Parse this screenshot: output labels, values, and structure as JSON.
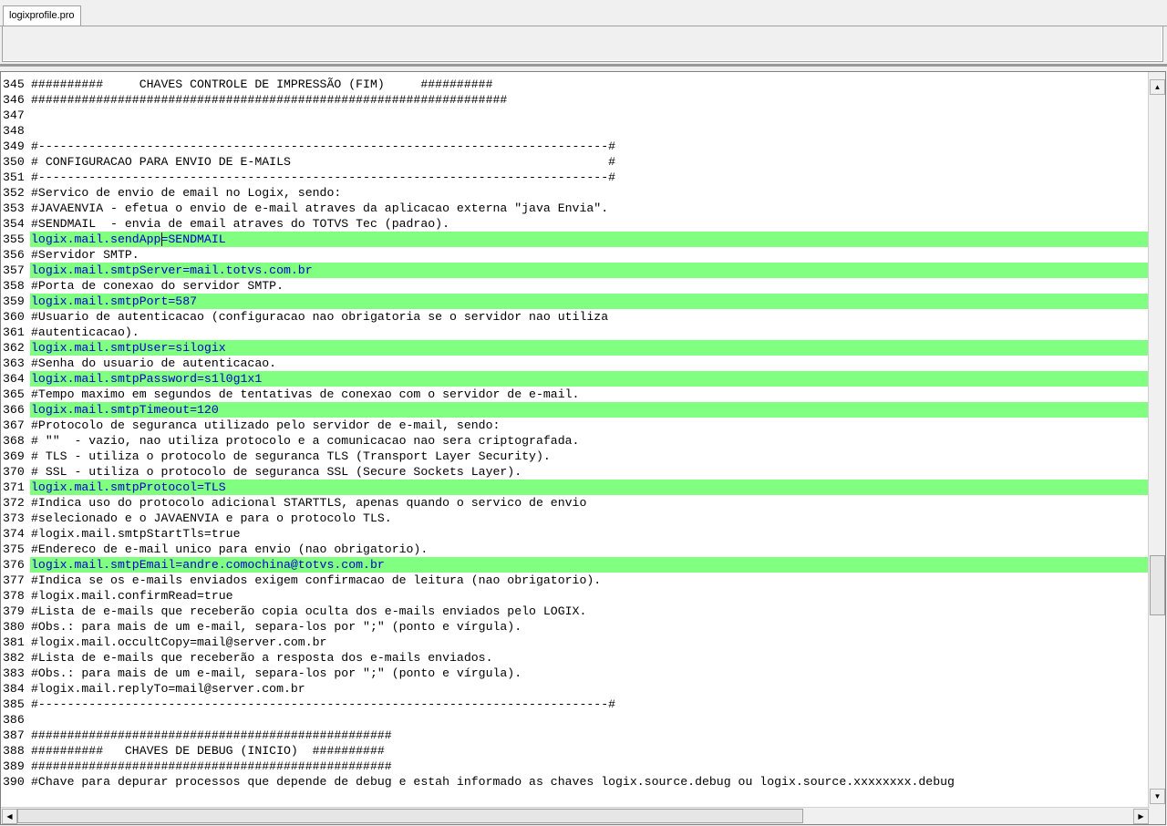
{
  "tab": {
    "label": "logixprofile.pro"
  },
  "editor": {
    "lines": [
      {
        "n": "345",
        "t": "##########     CHAVES CONTROLE DE IMPRESSÃO (FIM)     ##########",
        "hl": false
      },
      {
        "n": "346",
        "t": "##################################################################",
        "hl": false
      },
      {
        "n": "347",
        "t": "",
        "hl": false
      },
      {
        "n": "348",
        "t": "",
        "hl": false
      },
      {
        "n": "349",
        "t": "#-------------------------------------------------------------------------------#",
        "hl": false
      },
      {
        "n": "350",
        "t": "# CONFIGURACAO PARA ENVIO DE E-MAILS                                            #",
        "hl": false
      },
      {
        "n": "351",
        "t": "#-------------------------------------------------------------------------------#",
        "hl": false
      },
      {
        "n": "352",
        "t": "#Servico de envio de email no Logix, sendo:",
        "hl": false
      },
      {
        "n": "353",
        "t": "#JAVAENVIA - efetua o envio de e-mail atraves da aplicacao externa \"java Envia\".",
        "hl": false
      },
      {
        "n": "354",
        "t": "#SENDMAIL  - envia de email atraves do TOTVS Tec (padrao).",
        "hl": false
      },
      {
        "n": "355",
        "t": "logix.mail.sendApp=SENDMAIL",
        "hl": true,
        "caret": true
      },
      {
        "n": "356",
        "t": "#Servidor SMTP.",
        "hl": false
      },
      {
        "n": "357",
        "t": "logix.mail.smtpServer=mail.totvs.com.br",
        "hl": true
      },
      {
        "n": "358",
        "t": "#Porta de conexao do servidor SMTP.",
        "hl": false
      },
      {
        "n": "359",
        "t": "logix.mail.smtpPort=587",
        "hl": true
      },
      {
        "n": "360",
        "t": "#Usuario de autenticacao (configuracao nao obrigatoria se o servidor nao utiliza",
        "hl": false
      },
      {
        "n": "361",
        "t": "#autenticacao).",
        "hl": false
      },
      {
        "n": "362",
        "t": "logix.mail.smtpUser=silogix",
        "hl": true
      },
      {
        "n": "363",
        "t": "#Senha do usuario de autenticacao.",
        "hl": false
      },
      {
        "n": "364",
        "t": "logix.mail.smtpPassword=s1l0g1x1",
        "hl": true
      },
      {
        "n": "365",
        "t": "#Tempo maximo em segundos de tentativas de conexao com o servidor de e-mail.",
        "hl": false
      },
      {
        "n": "366",
        "t": "logix.mail.smtpTimeout=120",
        "hl": true
      },
      {
        "n": "367",
        "t": "#Protocolo de seguranca utilizado pelo servidor de e-mail, sendo:",
        "hl": false
      },
      {
        "n": "368",
        "t": "# \"\"  - vazio, nao utiliza protocolo e a comunicacao nao sera criptografada.",
        "hl": false
      },
      {
        "n": "369",
        "t": "# TLS - utiliza o protocolo de seguranca TLS (Transport Layer Security).",
        "hl": false
      },
      {
        "n": "370",
        "t": "# SSL - utiliza o protocolo de seguranca SSL (Secure Sockets Layer).",
        "hl": false
      },
      {
        "n": "371",
        "t": "logix.mail.smtpProtocol=TLS",
        "hl": true
      },
      {
        "n": "372",
        "t": "#Indica uso do protocolo adicional STARTTLS, apenas quando o servico de envio",
        "hl": false
      },
      {
        "n": "373",
        "t": "#selecionado e o JAVAENVIA e para o protocolo TLS.",
        "hl": false
      },
      {
        "n": "374",
        "t": "#logix.mail.smtpStartTls=true",
        "hl": false
      },
      {
        "n": "375",
        "t": "#Endereco de e-mail unico para envio (nao obrigatorio).",
        "hl": false
      },
      {
        "n": "376",
        "t": "logix.mail.smtpEmail=andre.comochina@totvs.com.br",
        "hl": true
      },
      {
        "n": "377",
        "t": "#Indica se os e-mails enviados exigem confirmacao de leitura (nao obrigatorio).",
        "hl": false
      },
      {
        "n": "378",
        "t": "#logix.mail.confirmRead=true",
        "hl": false
      },
      {
        "n": "379",
        "t": "#Lista de e-mails que receberão copia oculta dos e-mails enviados pelo LOGIX.",
        "hl": false
      },
      {
        "n": "380",
        "t": "#Obs.: para mais de um e-mail, separa-los por \";\" (ponto e vírgula).",
        "hl": false
      },
      {
        "n": "381",
        "t": "#logix.mail.occultCopy=mail@server.com.br",
        "hl": false
      },
      {
        "n": "382",
        "t": "#Lista de e-mails que receberão a resposta dos e-mails enviados.",
        "hl": false
      },
      {
        "n": "383",
        "t": "#Obs.: para mais de um e-mail, separa-los por \";\" (ponto e vírgula).",
        "hl": false
      },
      {
        "n": "384",
        "t": "#logix.mail.replyTo=mail@server.com.br",
        "hl": false
      },
      {
        "n": "385",
        "t": "#-------------------------------------------------------------------------------#",
        "hl": false
      },
      {
        "n": "386",
        "t": "",
        "hl": false
      },
      {
        "n": "387",
        "t": "##################################################",
        "hl": false
      },
      {
        "n": "388",
        "t": "##########   CHAVES DE DEBUG (INICIO)  ##########",
        "hl": false
      },
      {
        "n": "389",
        "t": "##################################################",
        "hl": false
      },
      {
        "n": "390",
        "t": "#Chave para depurar processos que depende de debug e estah informado as chaves logix.source.debug ou logix.source.xxxxxxxx.debug",
        "hl": false
      }
    ],
    "highlight_color": "#80ff80"
  }
}
